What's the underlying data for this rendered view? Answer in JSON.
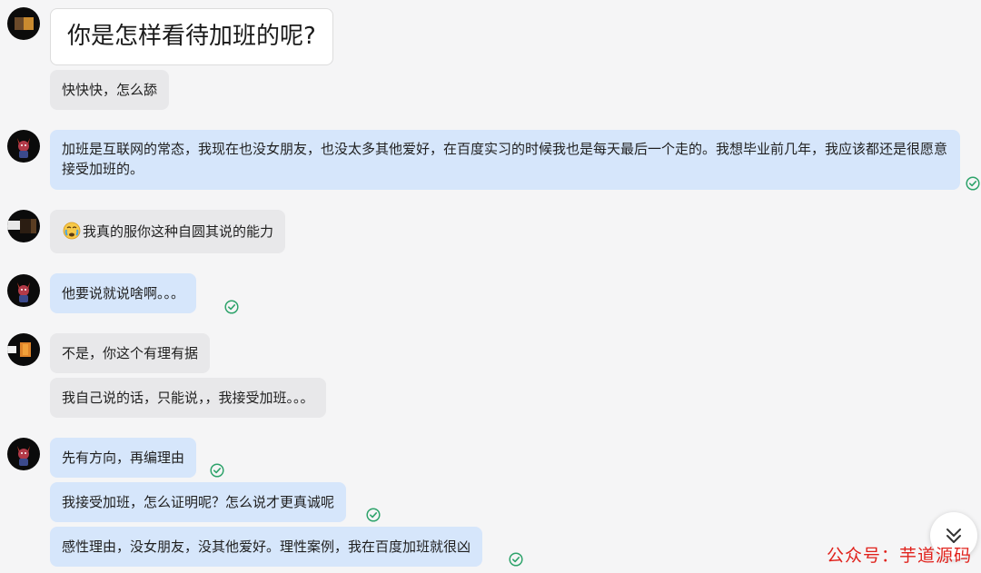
{
  "chat": {
    "messages": [
      {
        "id": "m1",
        "sender": "user",
        "text": "你是怎样看待加班的呢?"
      },
      {
        "id": "m2",
        "sender": "user",
        "text": "快快快，怎么舔"
      },
      {
        "id": "m3",
        "sender": "assistant",
        "text": "加班是互联网的常态，我现在也没女朋友，也没太多其他爱好，在百度实习的时候我也是每天最后一个走的。我想毕业前几年，我应该都还是很愿意接受加班的。"
      },
      {
        "id": "m4",
        "sender": "user",
        "text": "我真的服你这种自圆其说的能力",
        "emoji": "crying-face-emoji"
      },
      {
        "id": "m5",
        "sender": "assistant",
        "text": "他要说就说啥啊。。。"
      },
      {
        "id": "m6",
        "sender": "user",
        "text": "不是，你这个有理有据"
      },
      {
        "id": "m7",
        "sender": "user",
        "text": "我自己说的话，只能说，，我接受加班。。。"
      },
      {
        "id": "m8",
        "sender": "assistant",
        "text": "先有方向，再编理由"
      },
      {
        "id": "m9",
        "sender": "assistant",
        "text": "我接受加班，怎么证明呢？怎么说才更真诚呢"
      },
      {
        "id": "m10",
        "sender": "assistant",
        "text": "感性理由，没女朋友，没其他爱好。理性案例，我在百度加班就很凶"
      }
    ]
  },
  "watermark": "公众号：芋道源码",
  "icons": {
    "sent_check": "check-circle-icon",
    "scroll_down": "double-chevron-down-icon"
  },
  "colors": {
    "user_bubble": "#e8e8ea",
    "assistant_bubble": "#d6e6fb",
    "check": "#2ea36b",
    "watermark": "#e0221c"
  }
}
